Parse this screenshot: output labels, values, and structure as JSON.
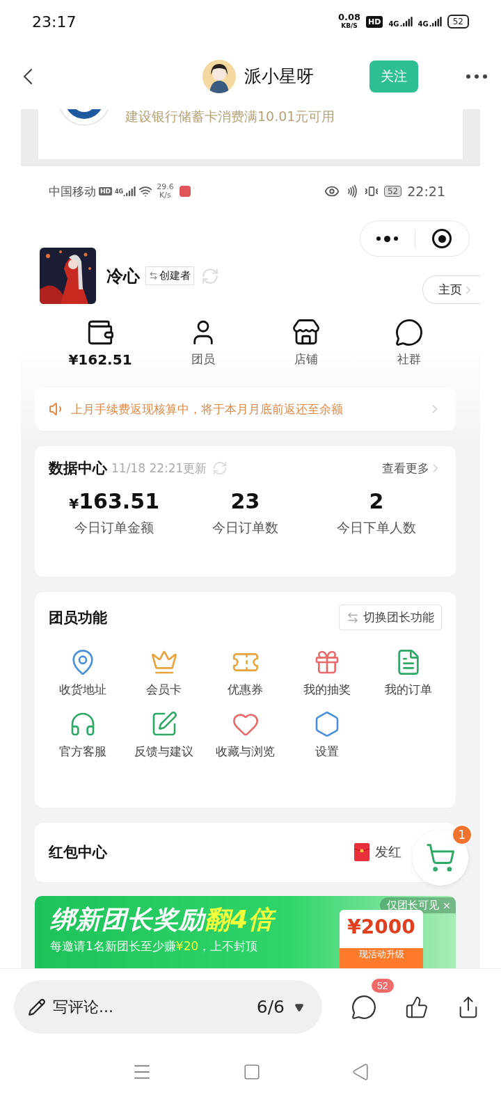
{
  "status_bar": {
    "time": "23:17",
    "speed": "0.08",
    "speed_unit": "KB/S",
    "hd": "HD",
    "networks": [
      "4G",
      "4G"
    ],
    "battery": "52"
  },
  "header": {
    "author": "派小星呀",
    "follow": "关注"
  },
  "post_image": {
    "top_card": {
      "text": "建设银行储蓄卡消费满10.01元可用"
    },
    "inner_status": {
      "carrier": "中国移动",
      "hd": "HD",
      "network": "4G",
      "speed": "29.6",
      "speed_unit": "K/s",
      "battery": "52",
      "time": "22:21"
    },
    "profile": {
      "name": "冷心",
      "role": "创建者",
      "home": "主页"
    },
    "shortcuts": [
      {
        "kind": "amount",
        "label": "¥162.51"
      },
      {
        "kind": "label",
        "label": "团员"
      },
      {
        "kind": "label",
        "label": "店铺"
      },
      {
        "kind": "label",
        "label": "社群"
      }
    ],
    "notice": "上月手续费返现核算中，将于本月月底前返还至余额",
    "data_center": {
      "title": "数据中心",
      "updated": "11/18 22:21更新",
      "more": "查看更多",
      "stats": [
        {
          "currency": "¥",
          "value": "163.51",
          "label": "今日订单金额"
        },
        {
          "value": "23",
          "label": "今日订单数"
        },
        {
          "value": "2",
          "label": "今日下单人数"
        }
      ]
    },
    "member_functions": {
      "title": "团员功能",
      "switch": "切换团长功能",
      "items": [
        {
          "label": "收货地址",
          "color": "#4a90d9"
        },
        {
          "label": "会员卡",
          "color": "#e8a33d"
        },
        {
          "label": "优惠券",
          "color": "#e8a33d"
        },
        {
          "label": "我的抽奖",
          "color": "#e86a6a"
        },
        {
          "label": "我的订单",
          "color": "#2ea866"
        },
        {
          "label": "官方客服",
          "color": "#2ea866"
        },
        {
          "label": "反馈与建议",
          "color": "#2ea866"
        },
        {
          "label": "收藏与浏览",
          "color": "#e86a6a"
        },
        {
          "label": "设置",
          "color": "#4a90d9"
        }
      ]
    },
    "red_packet": {
      "title": "红包中心",
      "action": "发红"
    },
    "cart": {
      "badge": "1"
    },
    "banner": {
      "headline": "绑新团长奖励",
      "highlight": "翻4倍",
      "subline": "每邀请1名新团长至少赚",
      "sub_amount": "¥20",
      "sub_tail": "，上不封顶",
      "prize": "¥2000",
      "prize_caption": "现活动升级",
      "tag": "仅团长可见"
    }
  },
  "comment_bar": {
    "placeholder": "写评论...",
    "page": "6/6",
    "comment_count": "52"
  }
}
